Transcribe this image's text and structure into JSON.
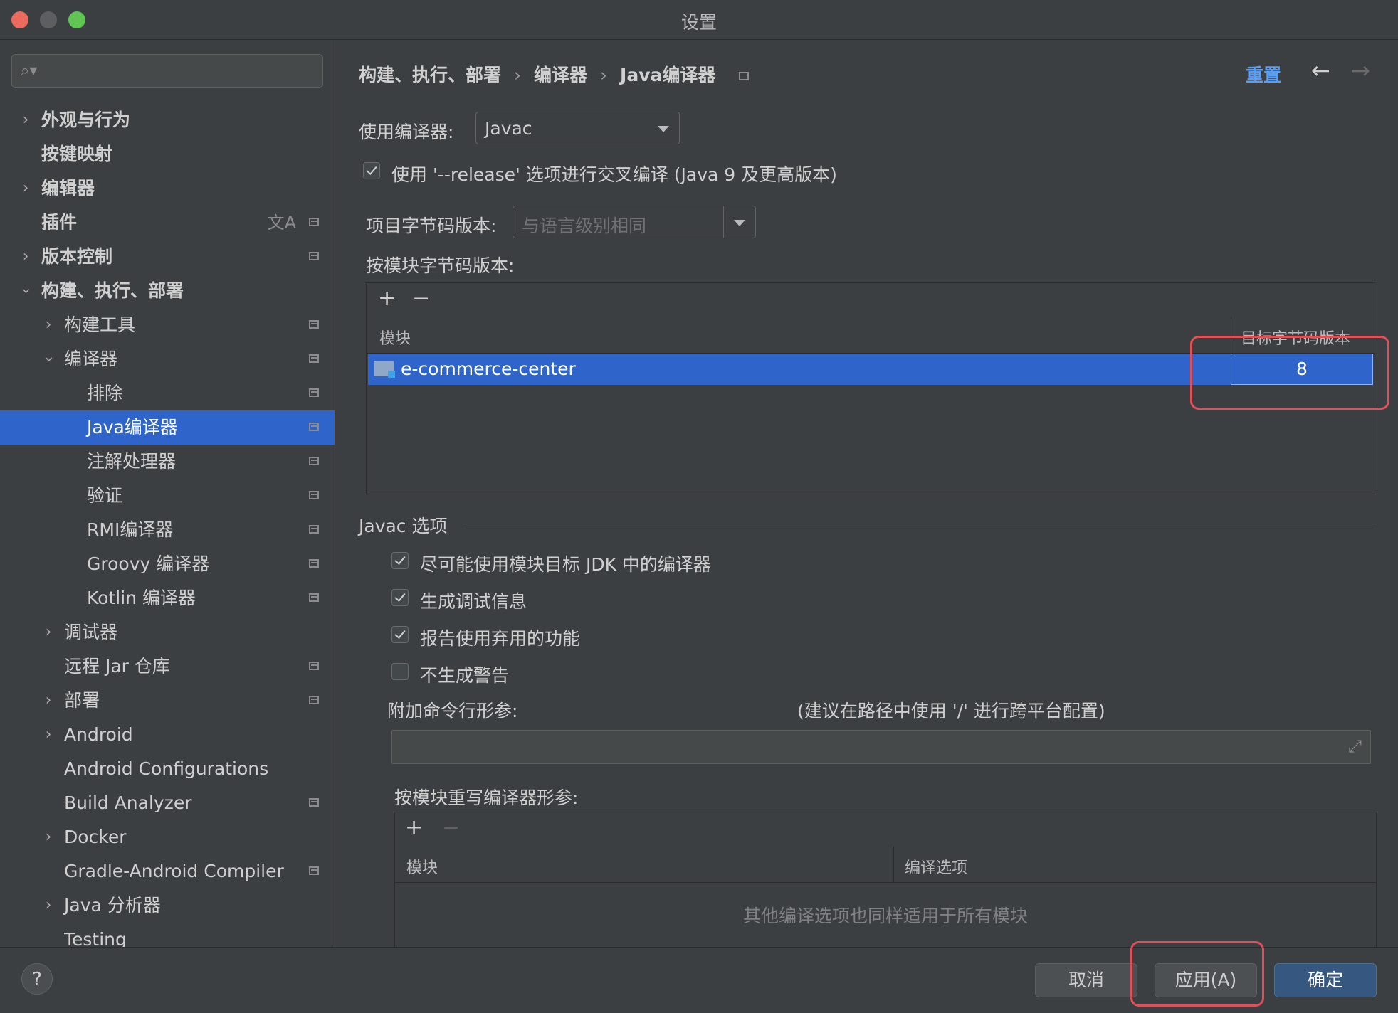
{
  "window": {
    "title": "设置"
  },
  "sidebar": {
    "search_placeholder": "",
    "items": [
      {
        "label": "外观与行为",
        "bold": true
      },
      {
        "label": "按键映射",
        "bold": true
      },
      {
        "label": "编辑器",
        "bold": true
      },
      {
        "label": "插件",
        "bold": true
      },
      {
        "label": "版本控制",
        "bold": true
      },
      {
        "label": "构建、执行、部署",
        "bold": true
      },
      {
        "label": "构建工具"
      },
      {
        "label": "编译器"
      },
      {
        "label": "排除"
      },
      {
        "label": "Java编译器"
      },
      {
        "label": "注解处理器"
      },
      {
        "label": "验证"
      },
      {
        "label": "RMI编译器"
      },
      {
        "label": "Groovy 编译器"
      },
      {
        "label": "Kotlin 编译器"
      },
      {
        "label": "调试器"
      },
      {
        "label": "远程 Jar 仓库"
      },
      {
        "label": "部署"
      },
      {
        "label": "Android"
      },
      {
        "label": "Android Configurations"
      },
      {
        "label": "Build Analyzer"
      },
      {
        "label": "Docker"
      },
      {
        "label": "Gradle-Android Compiler"
      },
      {
        "label": "Java 分析器"
      },
      {
        "label": "Testing"
      }
    ],
    "translate_icon": "文A"
  },
  "header": {
    "breadcrumb": [
      "构建、执行、部署",
      "编译器",
      "Java编译器"
    ],
    "breadcrumb_sep": "›",
    "reset_label": "重置",
    "back_icon": "←",
    "forward_icon": "→"
  },
  "compiler": {
    "use_compiler_label": "使用编译器:",
    "use_compiler_value": "Javac",
    "release_option_label": "使用 '--release' 选项进行交叉编译 (Java 9 及更高版本)",
    "release_option_checked": true,
    "project_bytecode_label": "项目字节码版本:",
    "project_bytecode_value": "与语言级别相同",
    "per_module_label": "按模块字节码版本:",
    "per_module_table": {
      "add_icon": "+",
      "remove_icon": "−",
      "columns": [
        "模块",
        "目标字节码版本"
      ],
      "rows": [
        {
          "module": "e-commerce-center",
          "target": "8"
        }
      ]
    }
  },
  "javac": {
    "section_title": "Javac 选项",
    "options": [
      {
        "label": "尽可能使用模块目标 JDK 中的编译器",
        "checked": true
      },
      {
        "label": "生成调试信息",
        "checked": true
      },
      {
        "label": "报告使用弃用的功能",
        "checked": true
      },
      {
        "label": "不生成警告",
        "checked": false
      }
    ],
    "extra_args_label": "附加命令行形参:",
    "extra_args_hint": "(建议在路径中使用 '/' 进行跨平台配置)",
    "extra_args_value": "",
    "override_label": "按模块重写编译器形参:",
    "override_table": {
      "add_icon": "+",
      "remove_icon": "−",
      "columns": [
        "模块",
        "编译选项"
      ],
      "empty_text": "其他编译选项也同样适用于所有模块"
    }
  },
  "footer": {
    "help_label": "?",
    "cancel_label": "取消",
    "apply_label": "应用(A)",
    "ok_label": "确定"
  },
  "colors": {
    "selection": "#2f65ca",
    "link": "#589df6",
    "highlight": "#e0505a",
    "primary_button": "#365880"
  }
}
